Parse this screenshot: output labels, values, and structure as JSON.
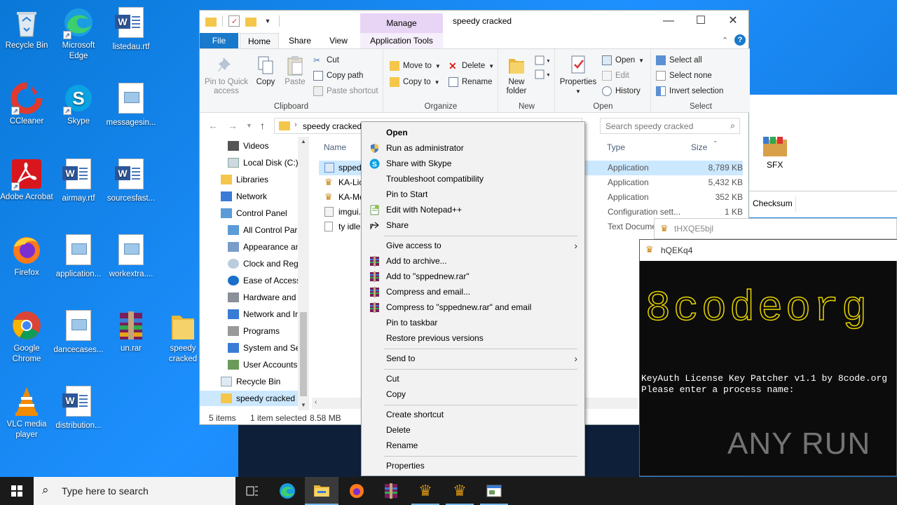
{
  "desktop": {
    "icons": [
      {
        "label": "Recycle Bin"
      },
      {
        "label": "Microsoft Edge"
      },
      {
        "label": "listedau.rtf"
      },
      {
        "label": "CCleaner"
      },
      {
        "label": "Skype"
      },
      {
        "label": "messagesin..."
      },
      {
        "label": "Adobe Acrobat"
      },
      {
        "label": "airmay.rtf"
      },
      {
        "label": "sourcesfast..."
      },
      {
        "label": "Firefox"
      },
      {
        "label": "application..."
      },
      {
        "label": "workextra...."
      },
      {
        "label": "Google Chrome"
      },
      {
        "label": "dancecases..."
      },
      {
        "label": "un.rar"
      },
      {
        "label": "speedy cracked"
      },
      {
        "label": "VLC media player"
      },
      {
        "label": "distribution..."
      }
    ]
  },
  "explorer": {
    "title": "speedy cracked",
    "manage_label": "Manage",
    "tabs": {
      "file": "File",
      "home": "Home",
      "share": "Share",
      "view": "View",
      "app_tools": "Application Tools"
    },
    "ribbon": {
      "clipboard": {
        "name": "Clipboard",
        "pin": "Pin to Quick access",
        "copy": "Copy",
        "paste": "Paste",
        "cut": "Cut",
        "copy_path": "Copy path",
        "paste_shortcut": "Paste shortcut"
      },
      "organize": {
        "name": "Organize",
        "move_to": "Move to",
        "copy_to": "Copy to",
        "delete": "Delete",
        "rename": "Rename"
      },
      "new": {
        "name": "New",
        "new_folder": "New folder"
      },
      "open": {
        "name": "Open",
        "properties": "Properties",
        "open": "Open",
        "edit": "Edit",
        "history": "History"
      },
      "select": {
        "name": "Select",
        "select_all": "Select all",
        "select_none": "Select none",
        "invert": "Invert selection"
      }
    },
    "address": "speedy cracked",
    "search_placeholder": "Search speedy cracked",
    "nav": [
      {
        "label": "Videos"
      },
      {
        "label": "Local Disk (C:)"
      },
      {
        "label": "Libraries"
      },
      {
        "label": "Network"
      },
      {
        "label": "Control Panel"
      },
      {
        "label": "All Control Par"
      },
      {
        "label": "Appearance an"
      },
      {
        "label": "Clock and Regi"
      },
      {
        "label": "Ease of Access"
      },
      {
        "label": "Hardware and"
      },
      {
        "label": "Network and Ir"
      },
      {
        "label": "Programs"
      },
      {
        "label": "System and Se"
      },
      {
        "label": "User Accounts"
      },
      {
        "label": "Recycle Bin"
      },
      {
        "label": "speedy cracked"
      }
    ],
    "columns": {
      "name": "Name",
      "type": "Type",
      "size": "Size"
    },
    "files": [
      {
        "name": "sppedn",
        "type": "Application",
        "size": "8,789 KB"
      },
      {
        "name": "KA-Lic",
        "type": "Application",
        "size": "5,432 KB"
      },
      {
        "name": "KA-Me",
        "type": "Application",
        "size": "352 KB"
      },
      {
        "name": "imgui.",
        "type": "Configuration sett...",
        "size": "1 KB"
      },
      {
        "name": "ty idle",
        "type": "Text Docume",
        "size": ""
      }
    ],
    "status": {
      "items": "5 items",
      "selected": "1 item selected",
      "size": "8.58 MB"
    }
  },
  "context_menu": {
    "items": [
      {
        "label": "Open"
      },
      {
        "label": "Run as administrator"
      },
      {
        "label": "Share with Skype"
      },
      {
        "label": "Troubleshoot compatibility"
      },
      {
        "label": "Pin to Start"
      },
      {
        "label": "Edit with Notepad++"
      },
      {
        "label": "Share"
      },
      {
        "label": "Give access to"
      },
      {
        "label": "Add to archive..."
      },
      {
        "label": "Add to \"sppednew.rar\""
      },
      {
        "label": "Compress and email..."
      },
      {
        "label": "Compress to \"sppednew.rar\" and email"
      },
      {
        "label": "Pin to taskbar"
      },
      {
        "label": "Restore previous versions"
      },
      {
        "label": "Send to"
      },
      {
        "label": "Cut"
      },
      {
        "label": "Copy"
      },
      {
        "label": "Create shortcut"
      },
      {
        "label": "Delete"
      },
      {
        "label": "Rename"
      },
      {
        "label": "Properties"
      }
    ]
  },
  "bg_window": {
    "sfx": "SFX",
    "checksum": "Checksum"
  },
  "console1": {
    "title": "tHXQE5bjl"
  },
  "console2": {
    "title": "hQEKq4",
    "ascii": "8codeorg",
    "line1": "KeyAuth License Key Patcher v1.1 by 8code.org",
    "line2": "Please enter a process name:"
  },
  "watermark": "ANY RUN",
  "taskbar": {
    "search_placeholder": "Type here to search"
  }
}
